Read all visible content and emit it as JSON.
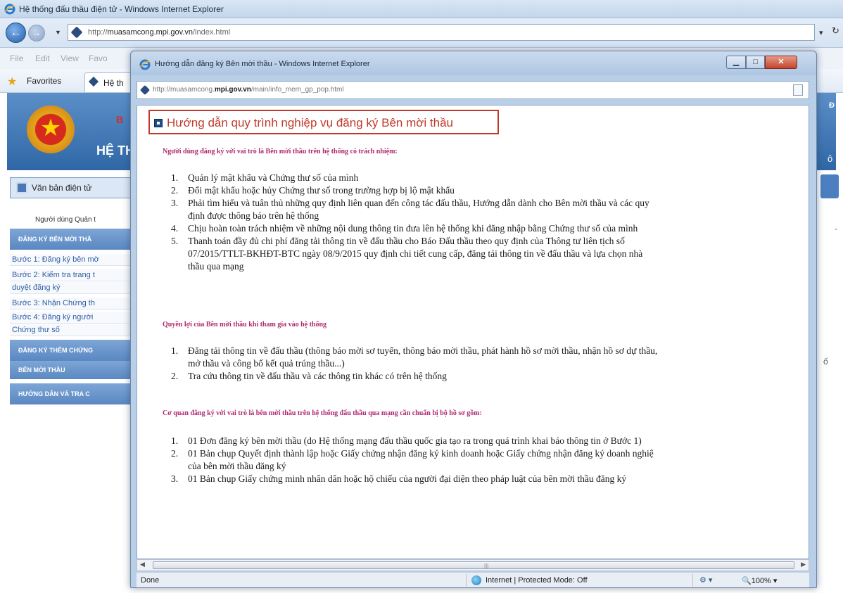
{
  "back_window": {
    "title": "Hệ thống đấu thầu điện tử - Windows Internet Explorer",
    "url_prefix": "http://",
    "url_domain": "muasamcong.mpi.gov.vn",
    "url_path": "/index.html",
    "menu": [
      "File",
      "Edit",
      "View",
      "Favo"
    ],
    "favorites_label": "Favorites",
    "tab_label": "Hệ th",
    "header_line1": "B",
    "header_line2": "HỆ TH",
    "header_right1": "Đ",
    "header_right2": "ô",
    "search_label": "Văn bản điện tử",
    "user_note": "Người dùng Quản t",
    "right_edge_text": "ố",
    "sidebar": {
      "section1": "ĐĂNG KÝ BÊN MỜI THẦ",
      "links": [
        "Bước 1: Đăng ký bên mờ",
        "Bước 2: Kiểm tra trang t",
        "duyệt đăng ký",
        "Bước 3: Nhận Chứng th",
        "Bước 4: Đăng ký người",
        "Chứng thư số"
      ],
      "section2": "ĐĂNG KÝ THÊM CHỨNG",
      "section3": "BÊN MỜI THẦU",
      "section4": "HƯỚNG DẪN VÀ TRA C"
    }
  },
  "popup": {
    "title": "Hướng dẫn đăng ký Bên mời thầu - Windows Internet Explorer",
    "url_prefix": "http://muasamcong.",
    "url_domain": "mpi.gov.vn",
    "url_path": "/main/info_mem_gp_pop.html",
    "heading": "Hướng dẫn quy trình nghiệp vụ đăng ký Bên mời thầu",
    "section1_title": "Người dùng đăng ký với vai trò là Bên mời thầu trên hệ thống có trách nhiệm:",
    "section1_items": [
      "Quản lý mật khẩu và Chứng thư số của mình",
      "Đổi mật khẩu hoặc hủy Chứng thư số trong trường hợp bị lộ mật khẩu",
      "Phải tìm hiểu và tuân thủ những quy định liên quan đến công tác đấu thầu, Hướng dẫn dành cho Bên mời thầu và các quy",
      "định được thông báo trên hệ thống",
      "Chịu hoàn toàn trách nhiệm về những nội dung thông tin đưa lên hệ thống khi đăng nhập bằng Chứng thư số của mình",
      "Thanh toán đầy đủ chi phí đăng tải thông tin về đấu thầu cho Báo Đấu thầu theo quy định của Thông tư liên tịch số",
      "07/2015/TTLT-BKHĐT-BTC ngày 08/9/2015 quy định chi tiết cung cấp, đăng tải thông tin về đấu thầu và lựa chọn nhà",
      "thầu qua mạng"
    ],
    "section2_title": "Quyền lợi của Bên mời thầu khi tham gia vào hệ thống",
    "section2_items": [
      "Đăng tải thông tin về đấu thầu (thông báo mời sơ tuyển, thông báo mời thầu, phát hành hồ sơ mời thầu, nhận hồ sơ dự thầu,",
      "mở thầu và công bố kết quả trúng thầu...)",
      "Tra cứu thông tin về đấu thầu và các thông tin khác có trên hệ thống"
    ],
    "section3_title": "Cơ quan đăng ký với vai trò là bên mời thầu trên hệ thống đấu thầu qua mạng cần chuẩn bị bộ hồ sơ gồm:",
    "section3_items": [
      "01 Đơn đăng ký bên mời thầu (do Hệ thống mạng đấu thầu quốc gia tạo ra trong quá trình khai báo thông tin ở Bước 1)",
      "01 Bản chụp Quyết định thành lập hoặc Giấy chứng nhận đăng ký kinh doanh hoặc Giấy chứng nhận đăng ký doanh nghiệ",
      "của bên mời thầu đăng ký",
      "01 Bản chụp Giấy chứng minh nhân dân hoặc hộ chiếu của người đại diện theo pháp luật của bên mời thầu đăng ký"
    ],
    "status_left": "Done",
    "status_zone": "Internet | Protected Mode: Off",
    "zoom": "100%"
  },
  "icons": {
    "ie": "ie-logo-icon",
    "page": "page-icon",
    "globe": "globe-icon",
    "star": "favorites-star-icon"
  },
  "colors": {
    "heading_red": "#c0392b",
    "section_magenta": "#b0286e",
    "header_blue": "#2f67a6"
  }
}
